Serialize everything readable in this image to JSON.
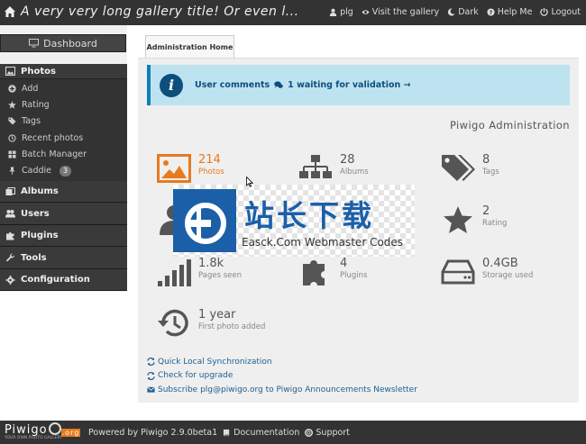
{
  "topbar": {
    "title": "A very very long gallery title! Or even l...",
    "links": [
      {
        "icon": "user-icon",
        "label": "plg"
      },
      {
        "icon": "eye-icon",
        "label": "Visit the gallery"
      },
      {
        "icon": "moon-icon",
        "label": "Dark"
      },
      {
        "icon": "help-icon",
        "label": "Help Me"
      },
      {
        "icon": "logout-icon",
        "label": "Logout"
      }
    ]
  },
  "sidebar": {
    "dashboard_label": "Dashboard",
    "photos_label": "Photos",
    "photo_items": [
      {
        "icon": "plus-circle-icon",
        "label": "Add"
      },
      {
        "icon": "star-icon",
        "label": "Rating"
      },
      {
        "icon": "tags-icon",
        "label": "Tags"
      },
      {
        "icon": "clock-icon",
        "label": "Recent photos"
      },
      {
        "icon": "batch-icon",
        "label": "Batch Manager"
      },
      {
        "icon": "pin-icon",
        "label": "Caddie",
        "badge": "3"
      }
    ],
    "sections": [
      {
        "icon": "albums-icon",
        "label": "Albums"
      },
      {
        "icon": "users-icon",
        "label": "Users"
      },
      {
        "icon": "puzzle-icon",
        "label": "Plugins"
      },
      {
        "icon": "wrench-icon",
        "label": "Tools"
      },
      {
        "icon": "gear-icon",
        "label": "Configuration"
      }
    ]
  },
  "tab": {
    "label": "Administration Home"
  },
  "info": {
    "prefix": "User comments",
    "message": "1 waiting for validation →"
  },
  "admin_title": "Piwigo Administration",
  "stats": [
    {
      "icon": "photos-icon",
      "value": "214",
      "label": "Photos",
      "color": "#e87a1e"
    },
    {
      "icon": "albums-tree-icon",
      "value": "28",
      "label": "Albums"
    },
    {
      "icon": "tags-icon",
      "value": "8",
      "label": "Tags"
    },
    {
      "icon": "user-icon",
      "value": "",
      "label": ""
    },
    {
      "icon": "star-icon",
      "value": "2",
      "label": "Rating"
    },
    {
      "icon": "signal-icon",
      "value": "1.8k",
      "label": "Pages seen"
    },
    {
      "icon": "puzzle-icon",
      "value": "4",
      "label": "Plugins"
    },
    {
      "icon": "hdd-icon",
      "value": "0.4GB",
      "label": "Storage used"
    },
    {
      "icon": "history-icon",
      "value": "1 year",
      "label": "First photo added"
    }
  ],
  "actions": [
    {
      "icon": "sync-icon",
      "label": "Quick Local Synchronization"
    },
    {
      "icon": "sync-icon",
      "label": "Check for upgrade"
    },
    {
      "icon": "envelope-icon",
      "label": "Subscribe plg@piwigo.org to Piwigo Announcements Newsletter"
    }
  ],
  "watermark": {
    "cn": "站长下载",
    "en": "Easck.Com Webmaster Codes"
  },
  "footer": {
    "brand": "Piwigo",
    "brand_tag": "YOUR OWN PHOTO GALLERY",
    "brand_org": ".org",
    "powered": "Powered by Piwigo 2.9.0beta1",
    "documentation": "Documentation",
    "support": "Support"
  },
  "colors": {
    "accent": "#e87a1e",
    "info_bg": "#bde3f1",
    "info_text": "#0d4f7c",
    "bar": "#333333"
  }
}
